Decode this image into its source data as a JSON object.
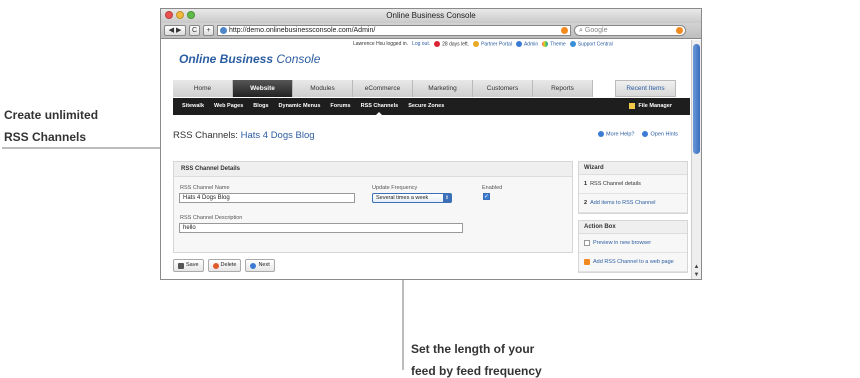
{
  "annotations": {
    "left_line1": "Create unlimited",
    "left_line2": "RSS Channels",
    "bottom_line1": "Set the length of your",
    "bottom_line2": "feed by feed frequency"
  },
  "browser": {
    "title": "Online Business Console",
    "url": "http://demo.onlinebusinessconsole.com/Admin/",
    "search_placeholder": "Google",
    "back_label": "◀ ▶",
    "reload_label": "C",
    "add_label": "+"
  },
  "header": {
    "logo_bold": "Online Business",
    "logo_rest": " Console",
    "user_text": "Lawrence Hsu logged in.",
    "logout": "Log out.",
    "days_left": "28 days left.",
    "partner_portal": "Partner Portal",
    "admin": "Admin",
    "theme": "Theme",
    "support": "Support Central"
  },
  "main_tabs": [
    "Home",
    "Website",
    "Modules",
    "eCommerce",
    "Marketing",
    "Customers",
    "Reports"
  ],
  "recent_items": "Recent Items",
  "sub_nav": [
    "Sitewalk",
    "Web Pages",
    "Blogs",
    "Dynamic Menus",
    "Forums",
    "RSS Channels",
    "Secure Zones"
  ],
  "file_manager": "File Manager",
  "page": {
    "title_prefix": "RSS Channels: ",
    "title_name": "Hats 4 Dogs Blog",
    "more_help": "More Help?",
    "open_hints": "Open Hints"
  },
  "form": {
    "panel_title": "RSS Channel Details",
    "name_label": "RSS Channel Name",
    "name_value": "Hats 4 Dogs Blog",
    "freq_label": "Update Frequency",
    "freq_value": "Several times a week",
    "enabled_label": "Enabled",
    "desc_label": "RSS Channel Description",
    "desc_value": "hello"
  },
  "buttons": {
    "save": "Save",
    "delete": "Delete",
    "next": "Next"
  },
  "wizard": {
    "title": "Wizard",
    "step1_num": "1",
    "step1_label": "RSS Channel details",
    "step2_num": "2",
    "step2_label": "Add items to RSS Channel"
  },
  "action_box": {
    "title": "Action Box",
    "item1": "Preview in new browser",
    "item2": "Add RSS Channel to a web page"
  }
}
